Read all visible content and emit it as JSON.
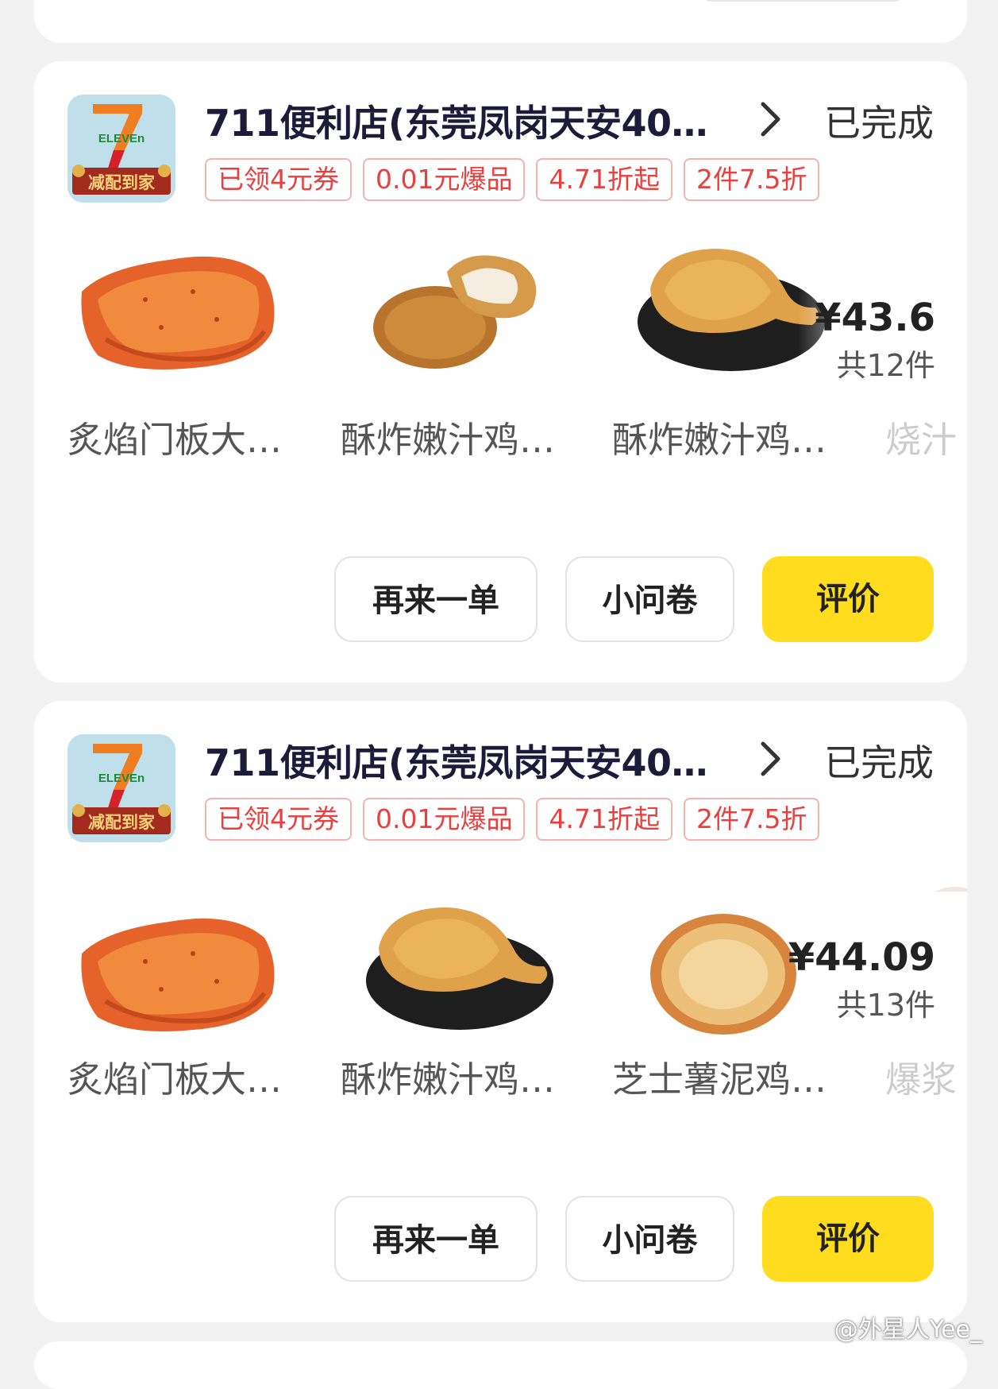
{
  "orders": [
    {
      "store_name": "711便利店(东莞凤岗天安40…",
      "status": "已完成",
      "logo": {
        "brand_text": "ELEVEn",
        "banner_text": "减配到家"
      },
      "tags": [
        "已领4元券",
        "0.01元爆品",
        "4.71折起",
        "2件7.5折"
      ],
      "products": [
        "炙焰门板大…",
        "酥炸嫩汁鸡…",
        "酥炸嫩汁鸡…",
        "烧汁"
      ],
      "price": "¥43.6",
      "count": "共12件",
      "buttons": {
        "reorder": "再来一单",
        "survey": "小问卷",
        "review": "评价"
      }
    },
    {
      "store_name": "711便利店(东莞凤岗天安40…",
      "status": "已完成",
      "logo": {
        "brand_text": "ELEVEn",
        "banner_text": "减配到家"
      },
      "tags": [
        "已领4元券",
        "0.01元爆品",
        "4.71折起",
        "2件7.5折"
      ],
      "products": [
        "炙焰门板大…",
        "酥炸嫩汁鸡…",
        "芝士薯泥鸡…",
        "爆浆"
      ],
      "price": "¥44.09",
      "count": "共13件",
      "buttons": {
        "reorder": "再来一单",
        "survey": "小问卷",
        "review": "评价"
      }
    }
  ],
  "watermark": "@外星人Yee_",
  "colors": {
    "accent_yellow": "#ffdc1e",
    "tag_red": "#e8403f",
    "store_title": "#1c1c3a"
  }
}
